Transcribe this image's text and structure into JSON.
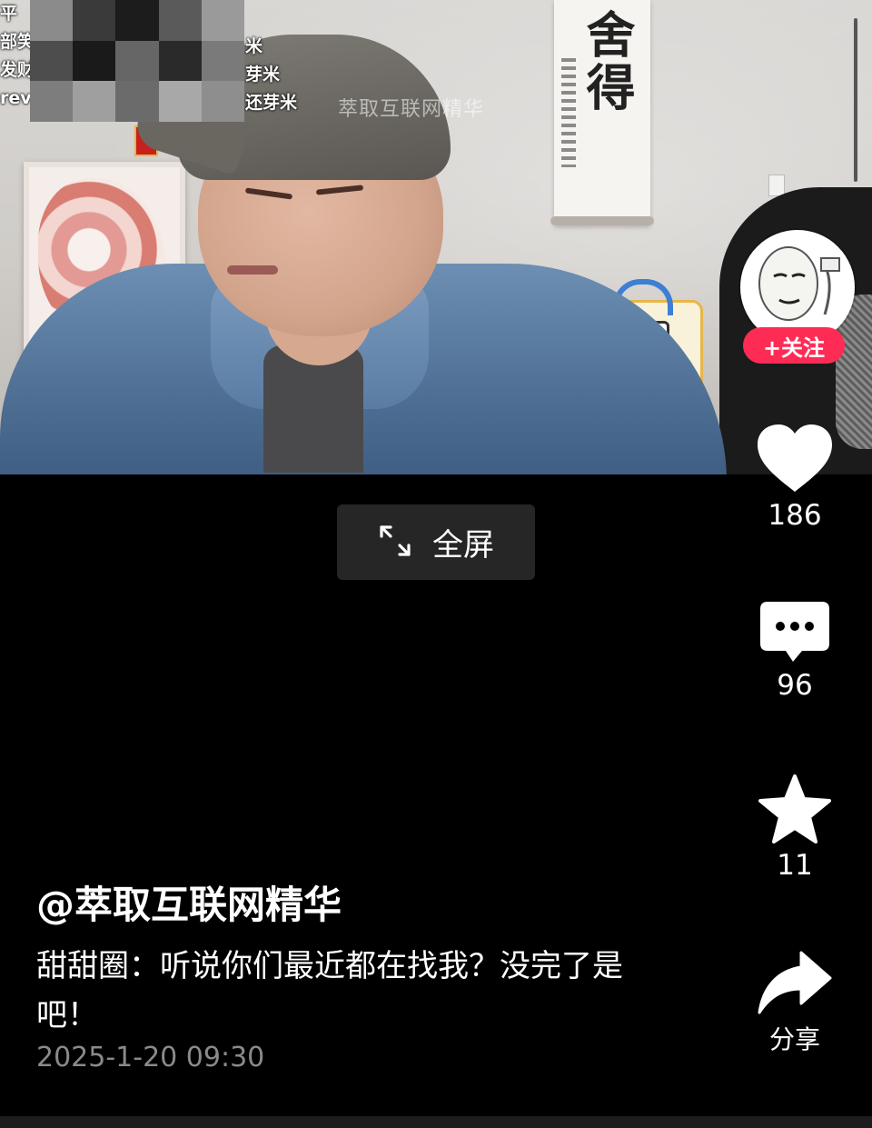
{
  "video": {
    "watermark": "萃取互联网精华",
    "danmaku_left": [
      "平",
      "部笑",
      "发财",
      "rev"
    ],
    "danmaku_right": [
      "米",
      "芽米",
      "还芽米"
    ]
  },
  "fullscreen_button": {
    "label": "全屏"
  },
  "sidebar": {
    "follow_label": "+关注",
    "like_count": "186",
    "comment_count": "96",
    "favorite_count": "11",
    "share_label": "分享"
  },
  "caption": {
    "author": "@萃取互联网精华",
    "text": "甜甜圈：听说你们最近都在找我？没完了是吧！",
    "timestamp": "2025-1-20 09:30"
  },
  "colors": {
    "background": "#000000",
    "follow_red": "#fe2c55",
    "timestamp_gray": "#8a8a8a"
  }
}
